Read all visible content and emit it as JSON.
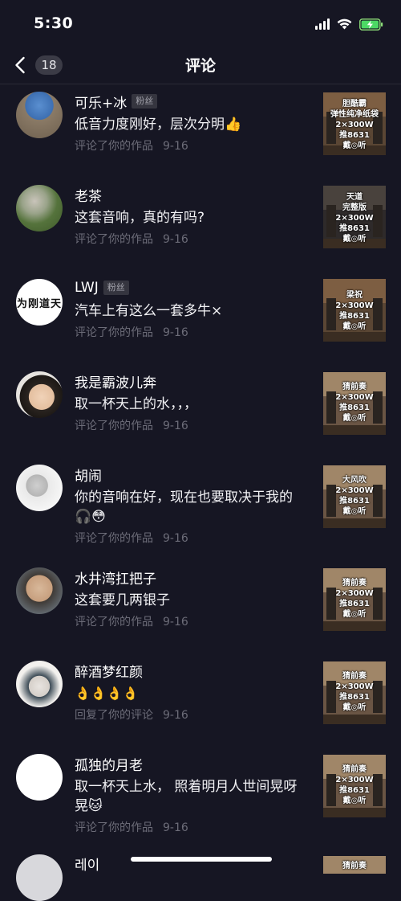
{
  "status_bar": {
    "time": "5:30"
  },
  "nav": {
    "back_count": "18",
    "title": "评论"
  },
  "colors": {
    "background": "#161623",
    "meta_text": "#6c6c78",
    "badge_bg": "#35353f"
  },
  "comments": [
    {
      "username": "可乐+冰",
      "badge": "粉丝",
      "text": "低音力度刚好，层次分明👍",
      "action": "评论了你的作品",
      "date": "9-16",
      "thumb": [
        "胆酷霸",
        "弹性纯净纸袋",
        "2×300W",
        "推8631",
        "戴◎听"
      ]
    },
    {
      "username": "老茶",
      "badge": "",
      "text": "这套音响，真的有吗?",
      "action": "评论了你的作品",
      "date": "9-16",
      "thumb": [
        "天道",
        "完整版",
        "2×300W",
        "推8631",
        "戴◎听"
      ]
    },
    {
      "username": "LWJ",
      "badge": "粉丝",
      "text": "汽车上有这么一套多牛×",
      "action": "评论了你的作品",
      "date": "9-16",
      "thumb": [
        "梁祝",
        "2×300W",
        "推8631",
        "戴◎听"
      ],
      "avatar_text": "为刚道天"
    },
    {
      "username": "我是霸波儿奔",
      "badge": "",
      "text": "取一杯天上的水，，，",
      "action": "评论了你的作品",
      "date": "9-16",
      "thumb": [
        "猜前奏",
        "2×300W",
        "推8631",
        "戴◎听"
      ]
    },
    {
      "username": "胡闹",
      "badge": "",
      "text": "你的音响在好，现在也要取决于我的🎧😳",
      "action": "评论了你的作品",
      "date": "9-16",
      "thumb": [
        "大风吹",
        "2×300W",
        "推8631",
        "戴◎听"
      ]
    },
    {
      "username": "水井湾扛把子",
      "badge": "",
      "text": "这套要几两银子",
      "action": "评论了你的作品",
      "date": "9-16",
      "thumb": [
        "猜前奏",
        "2×300W",
        "推8631",
        "戴◎听"
      ]
    },
    {
      "username": "醉酒梦红颜",
      "badge": "",
      "text": "👌👌👌👌",
      "action": "回复了你的评论",
      "date": "9-16",
      "thumb": [
        "猜前奏",
        "2×300W",
        "推8631",
        "戴◎听"
      ]
    },
    {
      "username": "孤独的月老",
      "badge": "",
      "text": "取一杯天上水， 照着明月人世间晃呀晃🐱",
      "action": "评论了你的作品",
      "date": "9-16",
      "thumb": [
        "猜前奏",
        "2×300W",
        "推8631",
        "戴◎听"
      ]
    },
    {
      "username": "레이",
      "badge": "",
      "text": "",
      "action": "",
      "date": "",
      "thumb": [
        "猜前奏"
      ]
    }
  ]
}
